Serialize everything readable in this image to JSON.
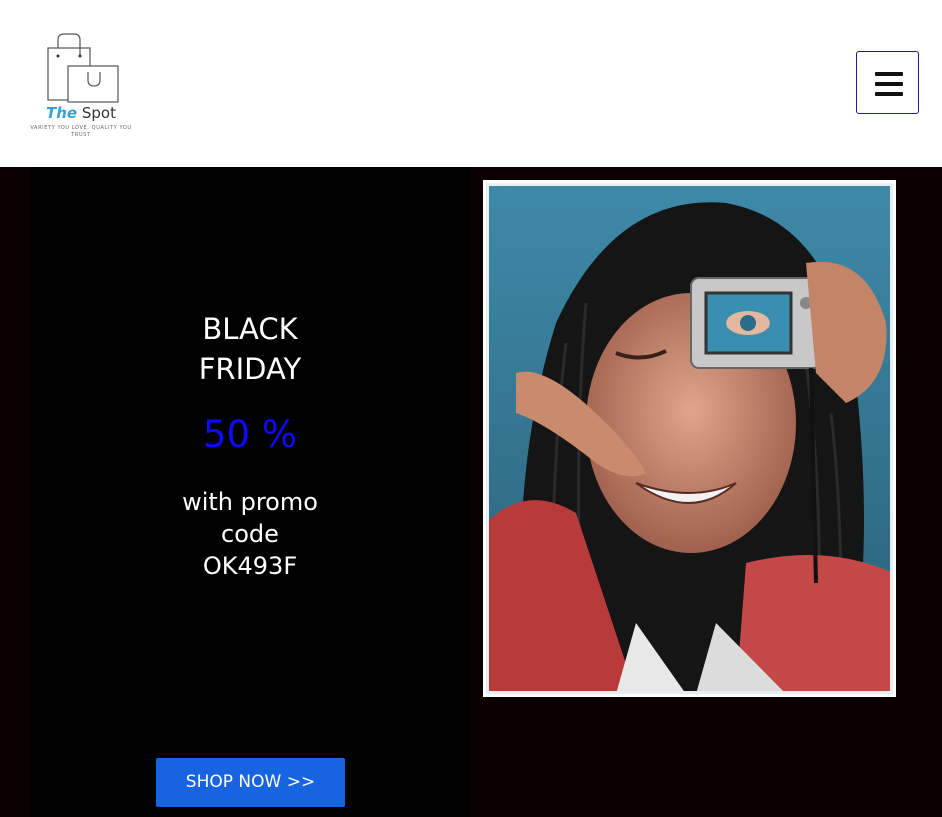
{
  "header": {
    "logo": {
      "brand_the": "The",
      "brand_spot": "Spot",
      "tagline": "VARIETY YOU LOVE, QUALITY YOU TRUST"
    },
    "menu_icon": "hamburger-menu-icon"
  },
  "promo": {
    "headline": "BLACK FRIDAY",
    "discount": "50 %",
    "code_text": "with promo code OK493F",
    "button_label": "SHOP NOW >>"
  },
  "colors": {
    "accent_blue": "#1763e0",
    "discount_blue": "#0b0bff",
    "background": "#000000"
  }
}
